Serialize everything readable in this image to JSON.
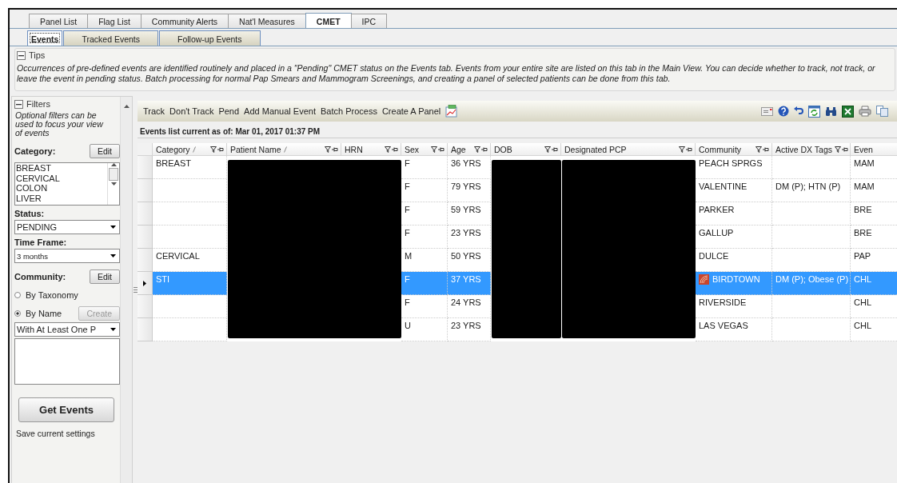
{
  "main_tabs": [
    {
      "label": "Panel List",
      "selected": false
    },
    {
      "label": "Flag List",
      "selected": false
    },
    {
      "label": "Community Alerts",
      "selected": false
    },
    {
      "label": "Nat'l Measures",
      "selected": false
    },
    {
      "label": "CMET",
      "selected": true
    },
    {
      "label": "IPC",
      "selected": false
    }
  ],
  "sub_tabs": [
    {
      "label": "Events",
      "selected": true
    },
    {
      "label": "Tracked Events",
      "selected": false
    },
    {
      "label": "Follow-up Events",
      "selected": false
    }
  ],
  "tips": {
    "title": "Tips",
    "expanded": true,
    "text": "Occurrences of pre-defined events are identified routinely and placed in a \"Pending\" CMET status on the Events tab.  Events from your entire site are listed on this tab in the Main View.  You can decide whether to track, not track, or leave the event in pending status.  Batch processing for normal Pap Smears and Mammogram Screenings, and creating a panel of selected patients can be done from this tab."
  },
  "filters": {
    "title": "Filters",
    "expanded": true,
    "description": "Optional filters can be used to focus your view of events",
    "category": {
      "label": "Category:",
      "edit_button": "Edit",
      "items": [
        "BREAST",
        "CERVICAL",
        "COLON",
        "LIVER"
      ]
    },
    "status": {
      "label": "Status:",
      "value": "PENDING"
    },
    "time_frame": {
      "label": "Time Frame:",
      "value": "3 months"
    },
    "community": {
      "label": "Community:",
      "edit_button": "Edit",
      "options": [
        {
          "label": "By Taxonomy",
          "selected": false
        },
        {
          "label": "By Name",
          "selected": true
        }
      ],
      "create_button": "Create",
      "create_disabled": true,
      "match": "With At Least One P"
    },
    "get_button": "Get Events",
    "footer": "Save current settings"
  },
  "toolbar": {
    "actions": [
      "Track",
      "Don't Track",
      "Pend",
      "Add Manual Event",
      "Batch Process",
      "Create A Panel"
    ]
  },
  "events_list": {
    "caption": "Events list current as of: Mar 01, 2017 01:37 PM",
    "columns": [
      {
        "label": "Category",
        "sorted": true,
        "filter": true
      },
      {
        "label": "Patient Name",
        "sorted": true,
        "filter": true
      },
      {
        "label": "HRN",
        "sorted": false,
        "filter": true
      },
      {
        "label": "Sex",
        "sorted": false,
        "filter": true
      },
      {
        "label": "Age",
        "sorted": false,
        "filter": true
      },
      {
        "label": "DOB",
        "sorted": false,
        "filter": true
      },
      {
        "label": "Designated PCP",
        "sorted": false,
        "filter": true
      },
      {
        "label": "Community",
        "sorted": false,
        "filter": true
      },
      {
        "label": "Active DX Tags",
        "sorted": false,
        "filter": true
      },
      {
        "label": "Even",
        "sorted": false,
        "filter": false
      }
    ],
    "rows": [
      {
        "selected": false,
        "flagged": false,
        "category": "BREAST",
        "sex": "F",
        "age": "36 YRS",
        "community": "PEACH SPRGS",
        "event": "MAM"
      },
      {
        "selected": false,
        "flagged": false,
        "sex": "F",
        "age": "79 YRS",
        "community": "VALENTINE",
        "dx_tags": "DM (P); HTN (P)",
        "event": "MAM"
      },
      {
        "selected": false,
        "flagged": false,
        "sex": "F",
        "age": "59 YRS",
        "community": "PARKER",
        "event": "BRE"
      },
      {
        "selected": false,
        "flagged": false,
        "sex": "F",
        "age": "23 YRS",
        "community": "GALLUP",
        "event": "BRE"
      },
      {
        "selected": false,
        "flagged": false,
        "category": "CERVICAL",
        "sex": "M",
        "age": "50 YRS",
        "community": "DULCE",
        "event": "PAP"
      },
      {
        "selected": true,
        "flagged": true,
        "category": "STI",
        "sex": "F",
        "age": "37 YRS",
        "community": "BIRDTOWN",
        "dx_tags": "DM (P); Obese (P)",
        "event": "CHL"
      },
      {
        "selected": false,
        "flagged": false,
        "sex": "F",
        "age": "24 YRS",
        "community": "RIVERSIDE",
        "event": "CHL"
      },
      {
        "selected": false,
        "flagged": false,
        "sex": "U",
        "age": "23 YRS",
        "community": "LAS VEGAS",
        "event": "CHL"
      }
    ]
  }
}
